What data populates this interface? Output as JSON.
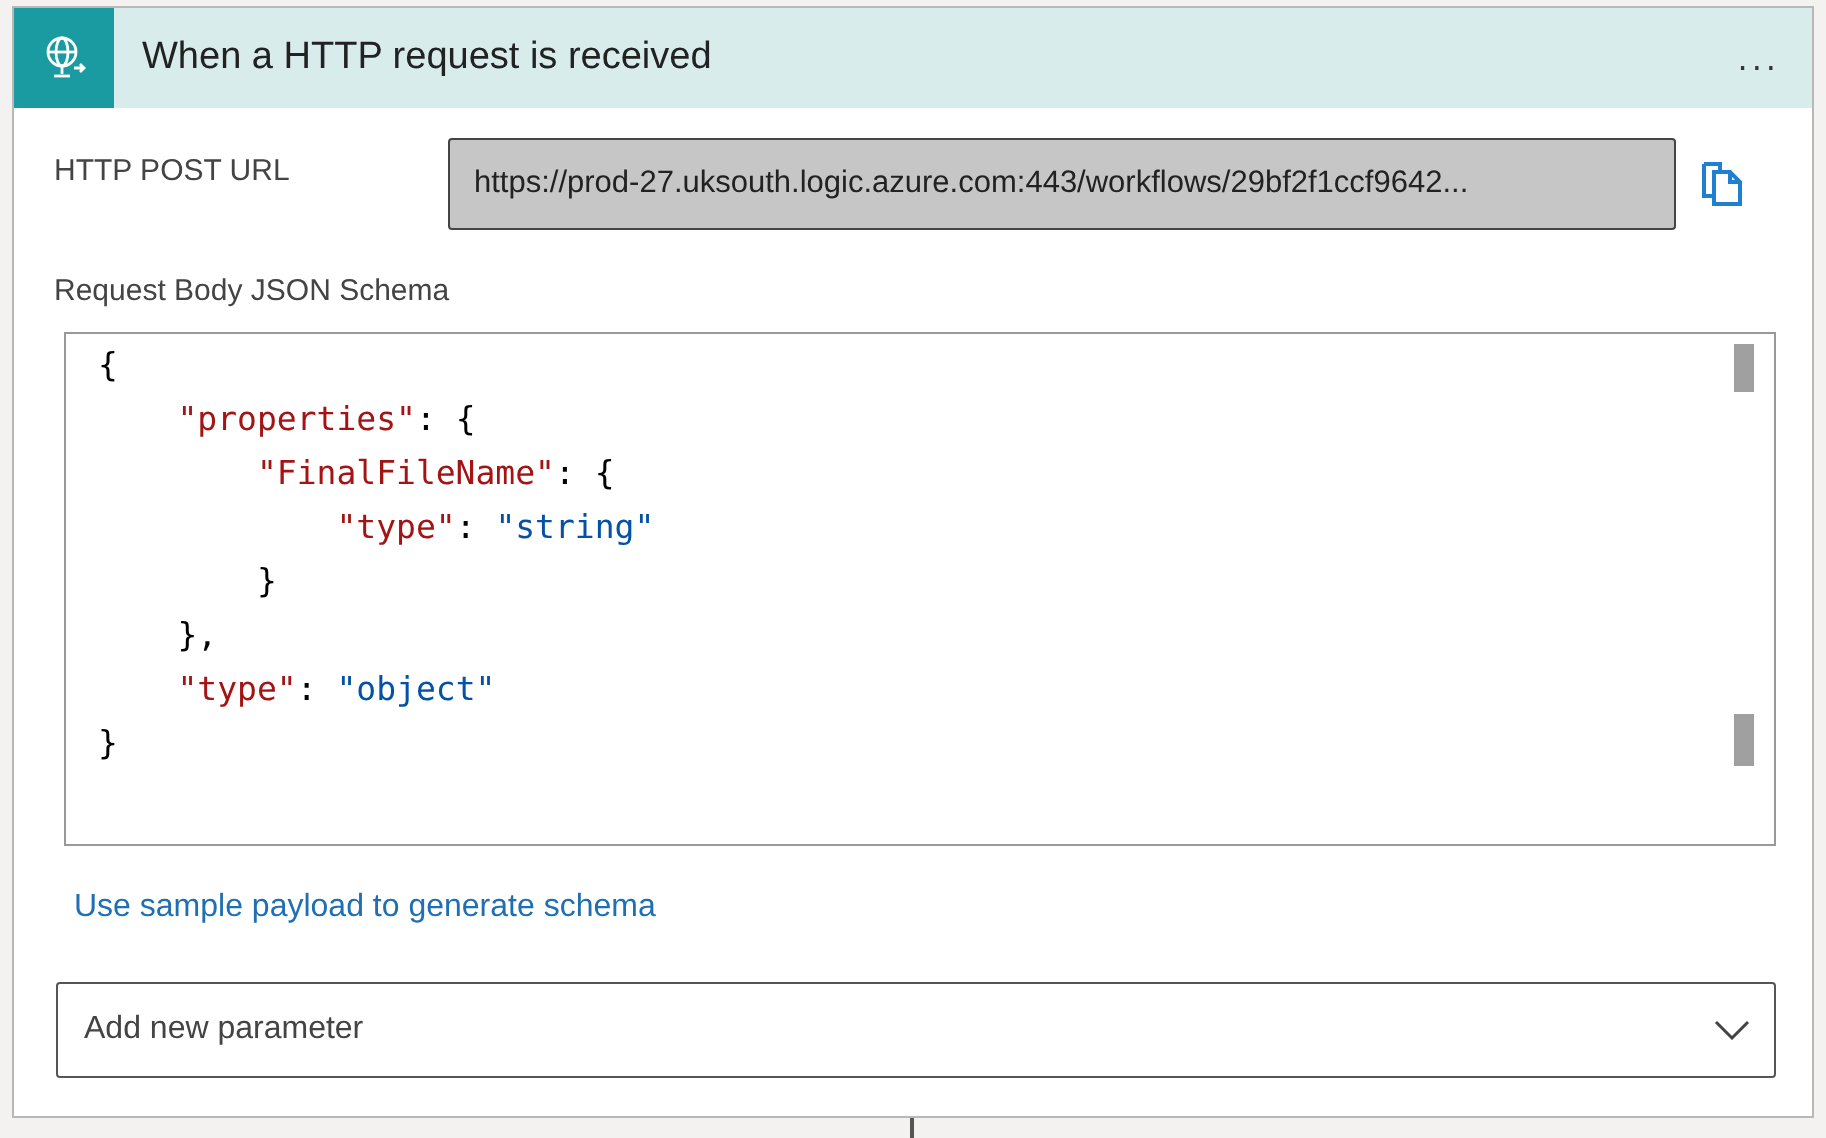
{
  "header": {
    "title": "When a HTTP request is received",
    "menu": "..."
  },
  "url_field": {
    "label": "HTTP POST URL",
    "value": "https://prod-27.uksouth.logic.azure.com:443/workflows/29bf2f1ccf9642..."
  },
  "schema": {
    "label": "Request Body JSON Schema",
    "lines": [
      [
        {
          "kind": "punct",
          "text": "{"
        }
      ],
      [
        {
          "kind": "key",
          "text": "    \"properties\""
        },
        {
          "kind": "punct",
          "text": ": {"
        }
      ],
      [
        {
          "kind": "key",
          "text": "        \"FinalFileName\""
        },
        {
          "kind": "punct",
          "text": ": {"
        }
      ],
      [
        {
          "kind": "key",
          "text": "            \"type\""
        },
        {
          "kind": "punct",
          "text": ": "
        },
        {
          "kind": "string",
          "text": "\"string\""
        }
      ],
      [
        {
          "kind": "punct",
          "text": "        }"
        }
      ],
      [
        {
          "kind": "punct",
          "text": "    },"
        }
      ],
      [
        {
          "kind": "key",
          "text": "    \"type\""
        },
        {
          "kind": "punct",
          "text": ": "
        },
        {
          "kind": "string",
          "text": "\"object\""
        }
      ],
      [
        {
          "kind": "punct",
          "text": "}"
        }
      ]
    ]
  },
  "link": "Use sample payload to generate schema",
  "parameter_dropdown": {
    "placeholder": "Add new parameter"
  }
}
